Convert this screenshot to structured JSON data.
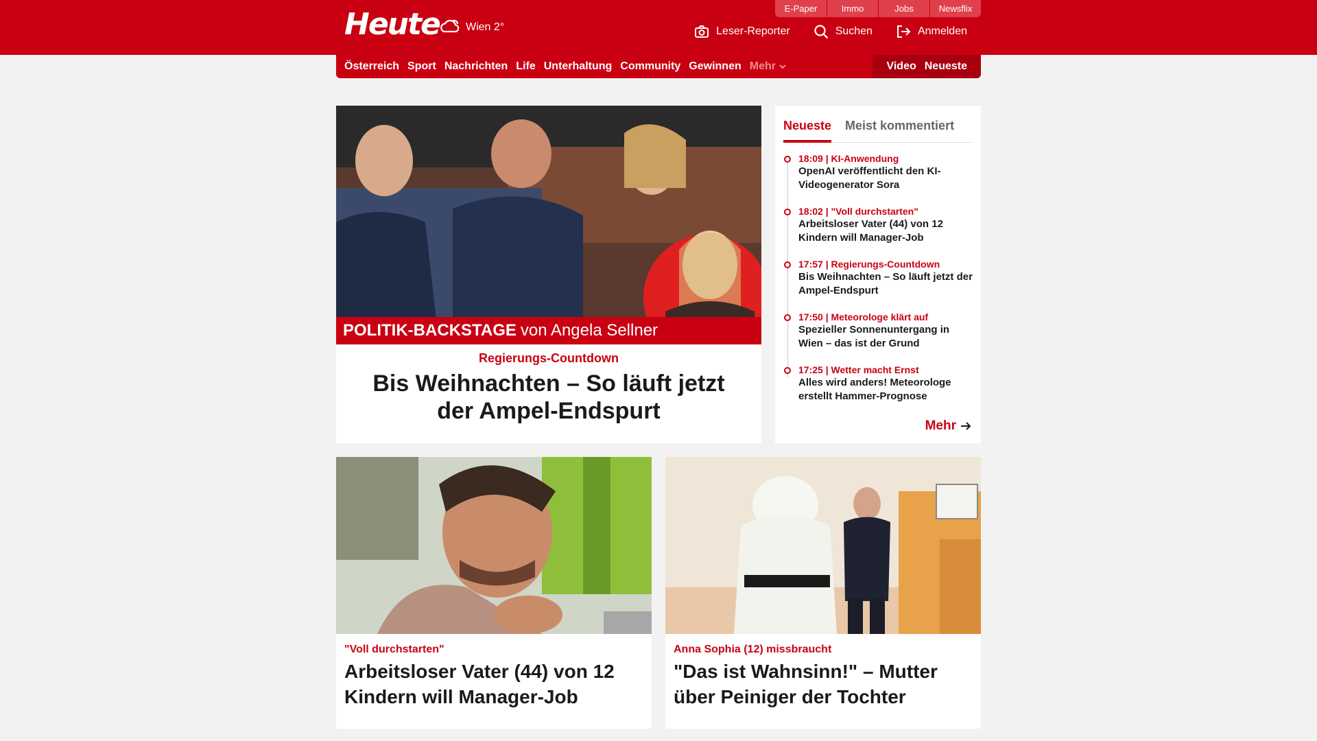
{
  "brand": {
    "logo": "Heute",
    "weather": "Wien 2°"
  },
  "ext_links": [
    "E-Paper",
    "Immo",
    "Jobs",
    "Newsflix"
  ],
  "utility": {
    "reporter": "Leser-Reporter",
    "search": "Suchen",
    "login": "Anmelden"
  },
  "nav": {
    "items": [
      "Österreich",
      "Sport",
      "Nachrichten",
      "Life",
      "Unterhaltung",
      "Community",
      "Gewinnen"
    ],
    "more": "Mehr",
    "right": [
      "Video",
      "Neueste"
    ]
  },
  "hero": {
    "banner_bold": "POLITIK-BACKSTAGE",
    "banner_rest": "von Angela Sellner",
    "kicker": "Regierungs-Countdown",
    "title": "Bis Weihnachten – So läuft jetzt der Ampel-Endspurt"
  },
  "sidebar": {
    "tabs": [
      "Neueste",
      "Meist kommentiert"
    ],
    "entries": [
      {
        "meta": "18:09 | KI-Anwendung",
        "headline": "OpenAI veröffentlicht den KI-Videogenerator Sora"
      },
      {
        "meta": "18:02 | \"Voll durchstarten\"",
        "headline": "Arbeitsloser Vater (44) von 12 Kindern will Manager-Job"
      },
      {
        "meta": "17:57 | Regierungs-Countdown",
        "headline": "Bis Weihnachten – So läuft jetzt der Ampel-Endspurt"
      },
      {
        "meta": "17:50 | Meteorologe klärt auf",
        "headline": "Spezieller Sonnenuntergang in Wien – das ist der Grund"
      },
      {
        "meta": "17:25 | Wetter macht Ernst",
        "headline": "Alles wird anders! Meteorologe erstellt Hammer-Prognose"
      }
    ],
    "more": "Mehr"
  },
  "cards": [
    {
      "kicker": "\"Voll durchstarten\"",
      "title": "Arbeitsloser Vater (44) von 12 Kindern will Manager-Job"
    },
    {
      "kicker": "Anna Sophia (12) missbraucht",
      "title": "\"Das ist Wahnsinn!\" – Mutter über Peiniger der Tochter"
    }
  ],
  "colors": {
    "brand_red": "#c90012",
    "dark_red": "#a8000f",
    "background": "#f2f2f2"
  }
}
